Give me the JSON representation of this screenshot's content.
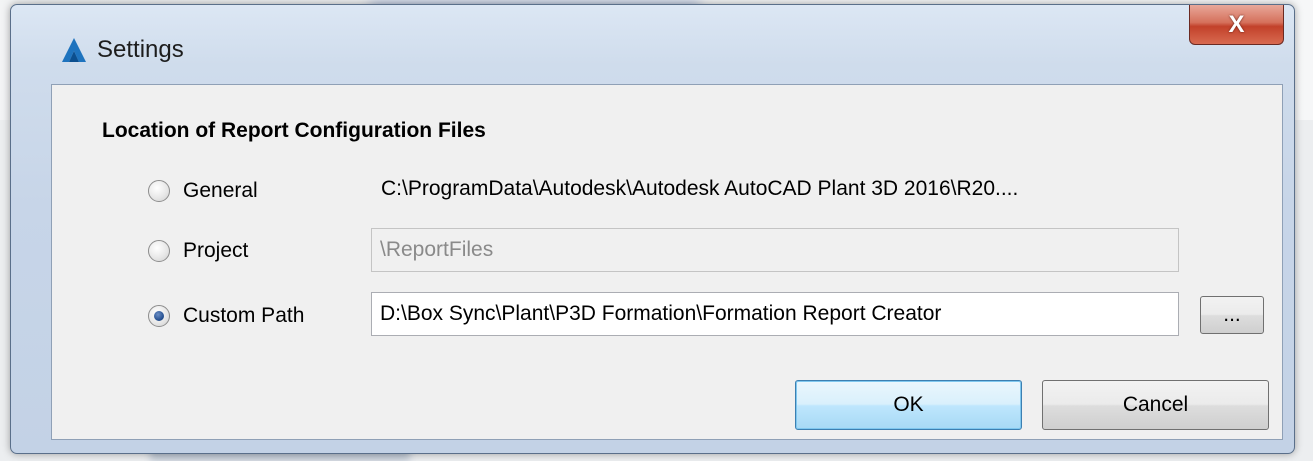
{
  "window": {
    "title": "Settings",
    "close_label": "X"
  },
  "section": {
    "title": "Location of Report Configuration Files"
  },
  "options": {
    "general": {
      "label": "General",
      "path": "C:\\ProgramData\\Autodesk\\Autodesk AutoCAD Plant 3D 2016\\R20....",
      "checked": false
    },
    "project": {
      "label": "Project",
      "value": "\\ReportFiles",
      "checked": false
    },
    "custom": {
      "label": "Custom Path",
      "value": "D:\\Box Sync\\Plant\\P3D Formation\\Formation Report Creator",
      "checked": true
    }
  },
  "buttons": {
    "browse_label": "...",
    "ok_label": "OK",
    "cancel_label": "Cancel"
  },
  "icons": {
    "app": "autodesk-a-icon",
    "close": "close-icon"
  },
  "colors": {
    "accent": "#1f4a8c",
    "close_button": "#c2412a",
    "app_icon": "#1e73be"
  }
}
